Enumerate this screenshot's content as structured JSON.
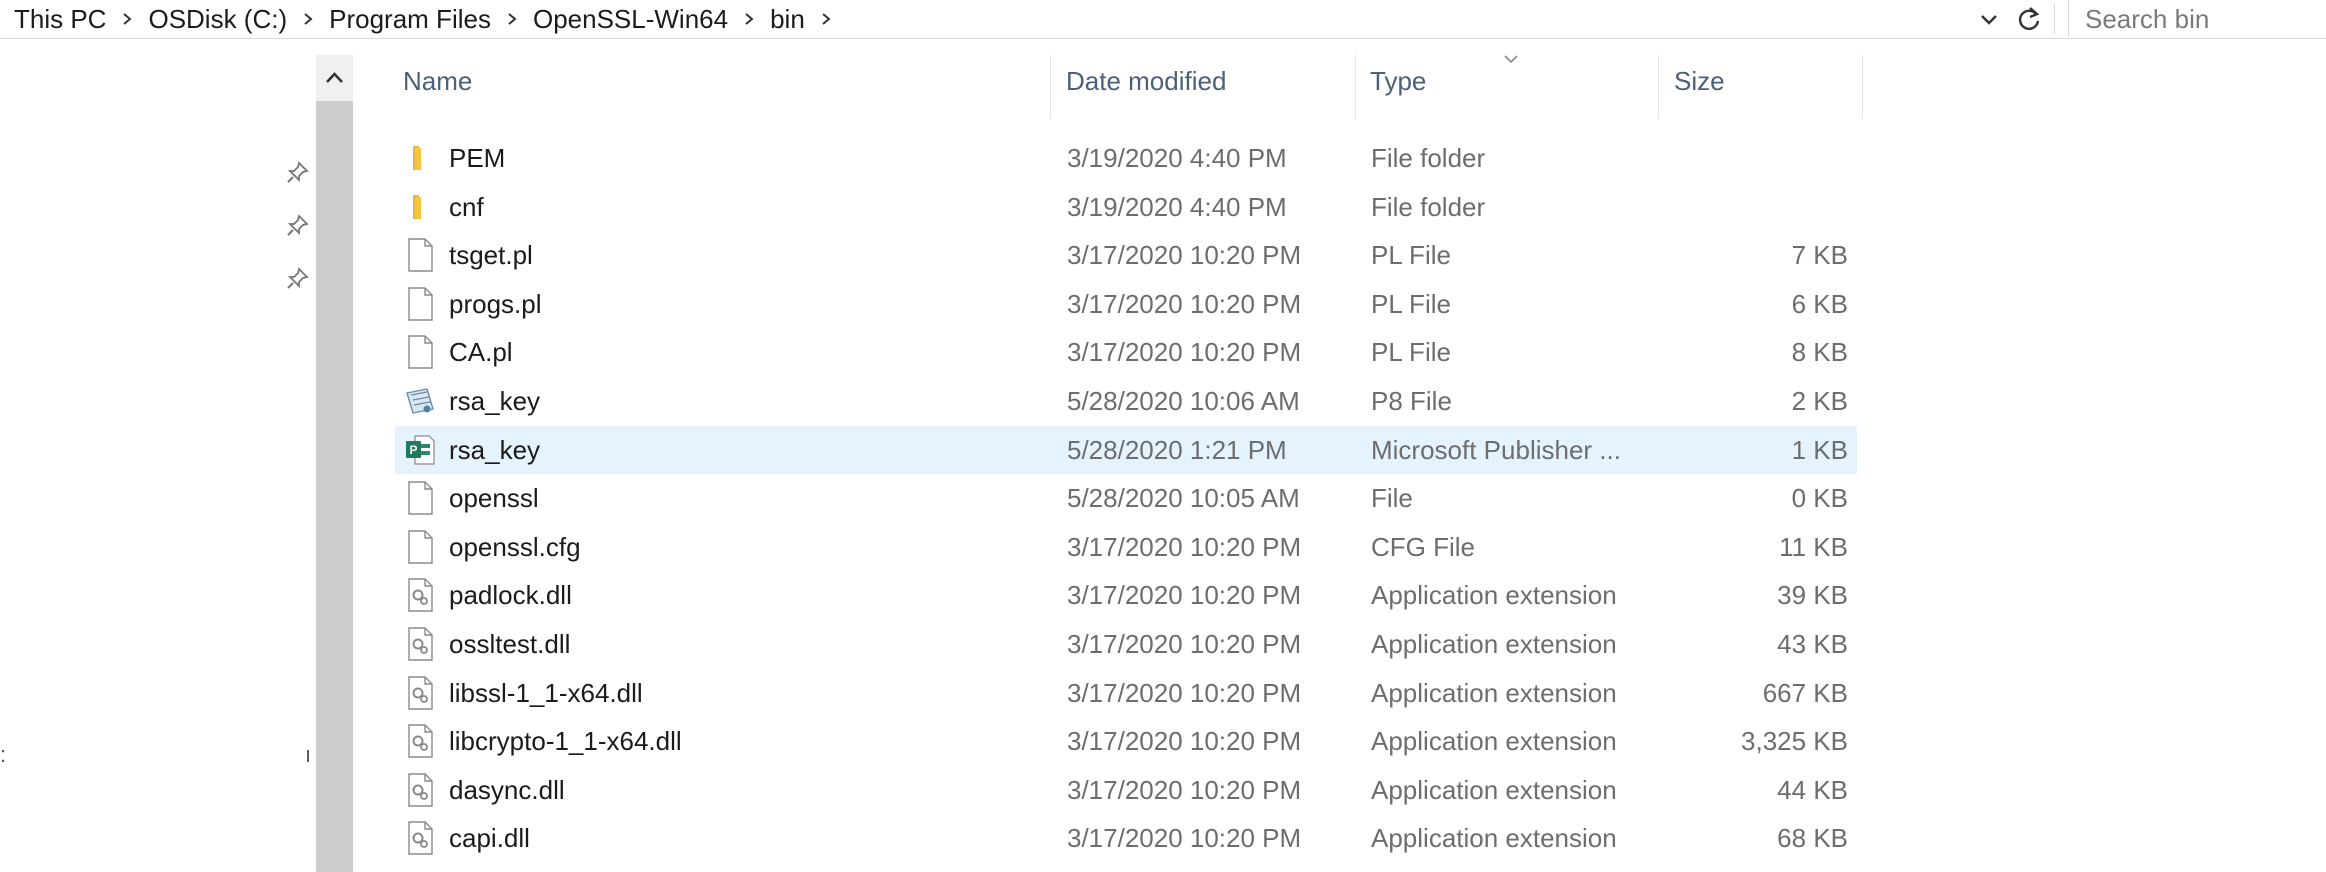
{
  "breadcrumb": [
    "This PC",
    "OSDisk (C:)",
    "Program Files",
    "OpenSSL-Win64",
    "bin"
  ],
  "search": {
    "placeholder": "Search bin"
  },
  "columns": {
    "name": "Name",
    "date": "Date modified",
    "type": "Type",
    "size": "Size"
  },
  "files": [
    {
      "name": "PEM",
      "date": "3/19/2020 4:40 PM",
      "type": "File folder",
      "size": "",
      "icon": "folder-icon"
    },
    {
      "name": "cnf",
      "date": "3/19/2020 4:40 PM",
      "type": "File folder",
      "size": "",
      "icon": "folder-icon"
    },
    {
      "name": "tsget.pl",
      "date": "3/17/2020 10:20 PM",
      "type": "PL File",
      "size": "7 KB",
      "icon": "file-icon"
    },
    {
      "name": "progs.pl",
      "date": "3/17/2020 10:20 PM",
      "type": "PL File",
      "size": "6 KB",
      "icon": "file-icon"
    },
    {
      "name": "CA.pl",
      "date": "3/17/2020 10:20 PM",
      "type": "PL File",
      "size": "8 KB",
      "icon": "file-icon"
    },
    {
      "name": "rsa_key",
      "date": "5/28/2020 10:06 AM",
      "type": "P8 File",
      "size": "2 KB",
      "icon": "certificate-file-icon"
    },
    {
      "name": "rsa_key",
      "date": "5/28/2020 1:21 PM",
      "type": "Microsoft Publisher ...",
      "size": "1 KB",
      "icon": "publisher-file-icon"
    },
    {
      "name": "openssl",
      "date": "5/28/2020 10:05 AM",
      "type": "File",
      "size": "0 KB",
      "icon": "file-icon"
    },
    {
      "name": "openssl.cfg",
      "date": "3/17/2020 10:20 PM",
      "type": "CFG File",
      "size": "11 KB",
      "icon": "file-icon"
    },
    {
      "name": "padlock.dll",
      "date": "3/17/2020 10:20 PM",
      "type": "Application extension",
      "size": "39 KB",
      "icon": "dll-file-icon"
    },
    {
      "name": "ossltest.dll",
      "date": "3/17/2020 10:20 PM",
      "type": "Application extension",
      "size": "43 KB",
      "icon": "dll-file-icon"
    },
    {
      "name": "libssl-1_1-x64.dll",
      "date": "3/17/2020 10:20 PM",
      "type": "Application extension",
      "size": "667 KB",
      "icon": "dll-file-icon"
    },
    {
      "name": "libcrypto-1_1-x64.dll",
      "date": "3/17/2020 10:20 PM",
      "type": "Application extension",
      "size": "3,325 KB",
      "icon": "dll-file-icon"
    },
    {
      "name": "dasync.dll",
      "date": "3/17/2020 10:20 PM",
      "type": "Application extension",
      "size": "44 KB",
      "icon": "dll-file-icon"
    },
    {
      "name": "capi.dll",
      "date": "3/17/2020 10:20 PM",
      "type": "Application extension",
      "size": "68 KB",
      "icon": "dll-file-icon"
    }
  ],
  "selected_row": 6,
  "colors": {
    "selection": "#e5f3ff",
    "header_text": "#4c607a",
    "folder": "#f4c542"
  }
}
